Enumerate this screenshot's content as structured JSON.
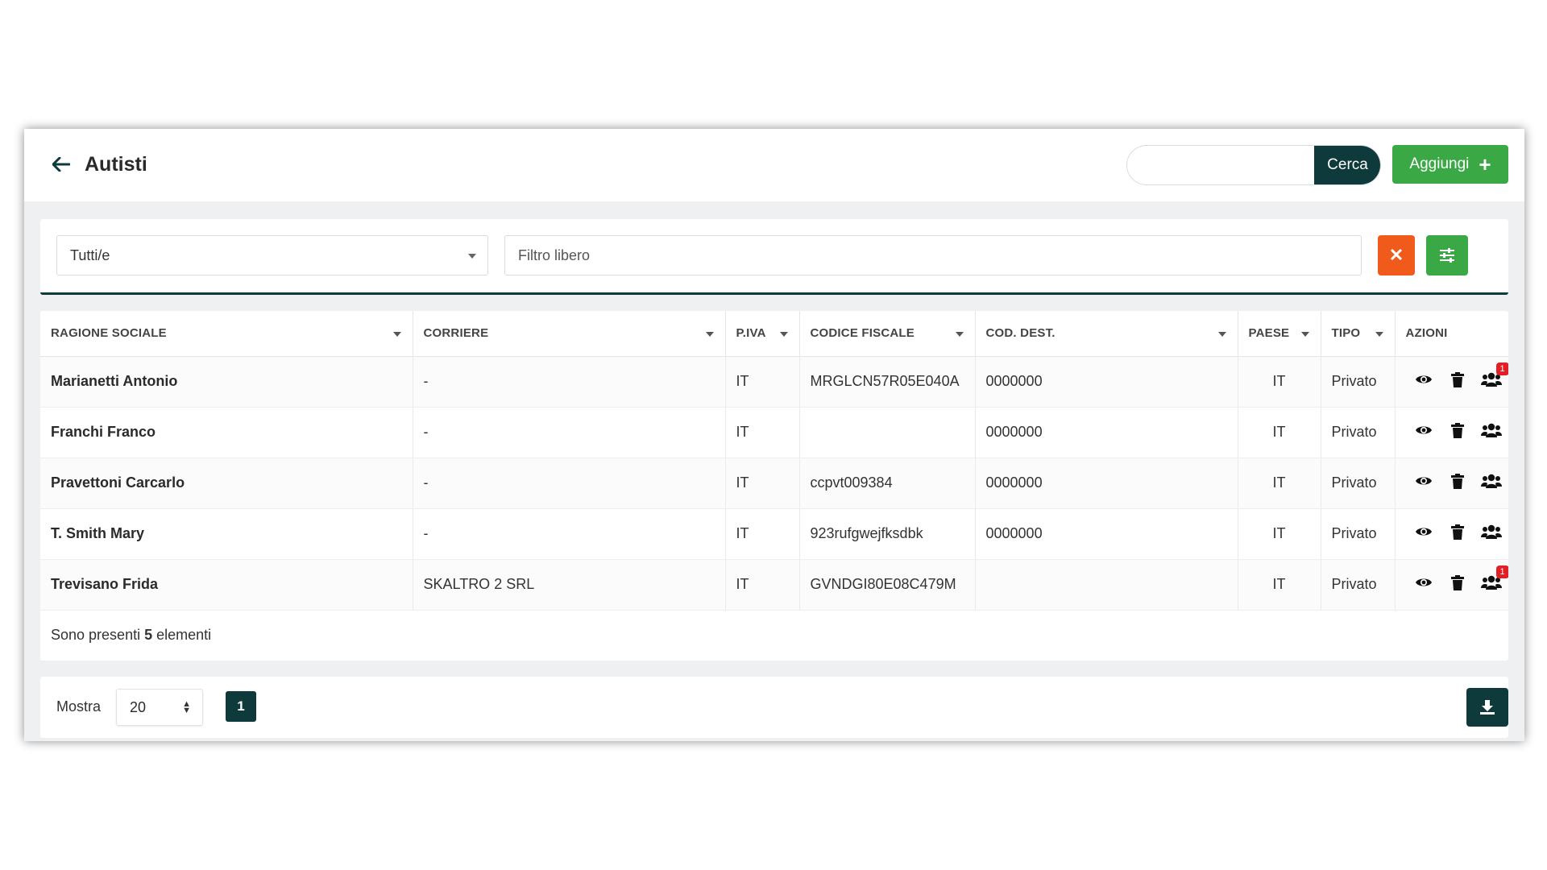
{
  "header": {
    "title": "Autisti",
    "search_placeholder": "",
    "search_button": "Cerca",
    "add_button": "Aggiungi"
  },
  "filters": {
    "type_select": "Tutti/e",
    "free_filter_placeholder": "Filtro libero"
  },
  "table": {
    "columns": [
      "Ragione sociale",
      "Corriere",
      "P.IVA",
      "Codice fiscale",
      "Cod. dest.",
      "Paese",
      "Tipo",
      "Azioni"
    ],
    "rows": [
      {
        "ragione_sociale": "Marianetti Antonio",
        "corriere": "-",
        "piva": "IT",
        "codice_fiscale": "MRGLCN57R05E040A",
        "cod_dest": "0000000",
        "paese": "IT",
        "tipo": "Privato",
        "badge": "1"
      },
      {
        "ragione_sociale": "Franchi Franco",
        "corriere": "-",
        "piva": "IT",
        "codice_fiscale": "",
        "cod_dest": "0000000",
        "paese": "IT",
        "tipo": "Privato",
        "badge": ""
      },
      {
        "ragione_sociale": "Pravettoni Carcarlo",
        "corriere": "-",
        "piva": "IT",
        "codice_fiscale": "ccpvt009384",
        "cod_dest": "0000000",
        "paese": "IT",
        "tipo": "Privato",
        "badge": ""
      },
      {
        "ragione_sociale": "T. Smith Mary",
        "corriere": "-",
        "piva": "IT",
        "codice_fiscale": "923rufgwejfksdbk",
        "cod_dest": "0000000",
        "paese": "IT",
        "tipo": "Privato",
        "badge": ""
      },
      {
        "ragione_sociale": "Trevisano Frida",
        "corriere": "SKALTRO 2 SRL",
        "piva": "IT",
        "codice_fiscale": "GVNDGI80E08C479M",
        "cod_dest": "",
        "paese": "IT",
        "tipo": "Privato",
        "badge": "1"
      }
    ],
    "count_prefix": "Sono presenti",
    "count_value": "5",
    "count_suffix": "elementi"
  },
  "footer": {
    "show_label": "Mostra",
    "page_size": "20",
    "current_page": "1"
  },
  "colors": {
    "primary_dark": "#0e3a3b",
    "success_green": "#3aa845",
    "danger_orange": "#f05a1a",
    "badge_red": "#e01f26"
  },
  "icons": {
    "back": "arrow-left-icon",
    "add": "plus-icon",
    "clear": "close-icon",
    "settings": "sliders-icon",
    "view": "eye-icon",
    "delete": "trash-icon",
    "users": "users-icon",
    "download": "download-icon"
  }
}
